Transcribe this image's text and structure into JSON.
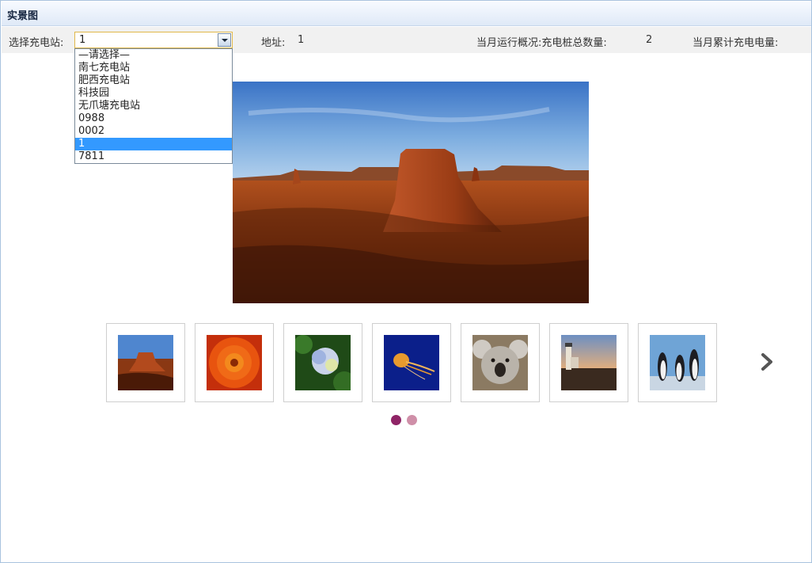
{
  "panel": {
    "title": "实景图"
  },
  "toolbar": {
    "station_label": "选择充电站:",
    "station_selected": "1",
    "address_label": "地址:",
    "address_value": "1",
    "overview_label": "当月运行概况:充电桩总数量:",
    "pile_count": "2",
    "energy_label": "当月累计充电电量:"
  },
  "dropdown": {
    "options": [
      "—请选择—",
      "南七充电站",
      "肥西充电站",
      "科技园",
      "无爪塘充电站",
      "0988",
      "0002",
      "1",
      "7811"
    ],
    "selected_index": 7
  },
  "main_photo": {
    "subject": "desert-mesa"
  },
  "thumbnails": [
    {
      "subject": "desert"
    },
    {
      "subject": "chrysanthemum"
    },
    {
      "subject": "hydrangeas"
    },
    {
      "subject": "jellyfish"
    },
    {
      "subject": "koala"
    },
    {
      "subject": "lighthouse"
    },
    {
      "subject": "penguins"
    }
  ],
  "pagination": {
    "current_page": 1,
    "total_pages": 2
  },
  "colors": {
    "dot_active": "#8f2466",
    "dot_inactive": "#cf8fa8",
    "selection": "#3399ff"
  }
}
